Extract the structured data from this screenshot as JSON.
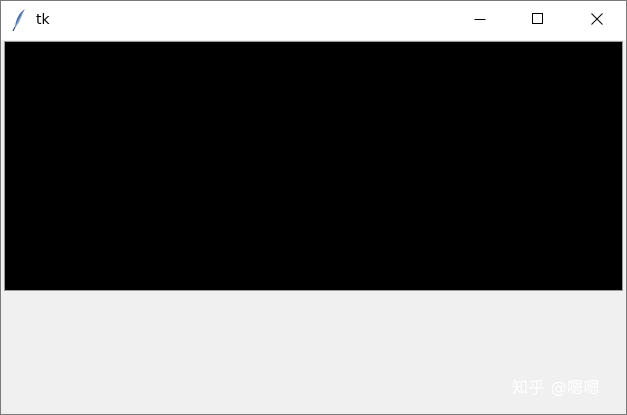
{
  "window": {
    "title": "tk",
    "icon": "feather-icon",
    "controls": {
      "minimize_icon": "minimize-icon",
      "maximize_icon": "maximize-icon",
      "close_icon": "close-icon"
    }
  },
  "canvas": {
    "background_color": "#000000"
  },
  "colors": {
    "window_background": "#f0f0f0",
    "titlebar_background": "#ffffff"
  },
  "watermark": {
    "text": "知乎 @嗯嗯"
  }
}
